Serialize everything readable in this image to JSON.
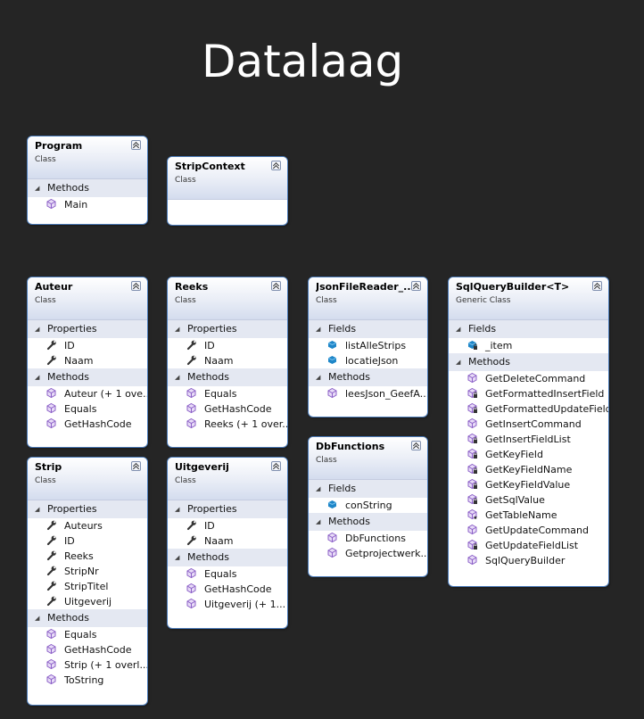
{
  "diagram_title": "Datalaag",
  "colors": {
    "background": "#252525",
    "border": "#4a7ab8",
    "method_icon": "#8b5fc7",
    "field_icon": "#1e86c8"
  },
  "classes": [
    {
      "name": "Program",
      "kind": "Class",
      "sections": [
        {
          "title": "Methods",
          "members": [
            {
              "label": "Main",
              "icon": "method-icon"
            }
          ]
        }
      ]
    },
    {
      "name": "StripContext",
      "kind": "Class",
      "sections": []
    },
    {
      "name": "Auteur",
      "kind": "Class",
      "sections": [
        {
          "title": "Properties",
          "members": [
            {
              "label": "ID",
              "icon": "wrench-icon"
            },
            {
              "label": "Naam",
              "icon": "wrench-icon"
            }
          ]
        },
        {
          "title": "Methods",
          "members": [
            {
              "label": "Auteur (+ 1 ove...",
              "icon": "method-icon"
            },
            {
              "label": "Equals",
              "icon": "method-icon"
            },
            {
              "label": "GetHashCode",
              "icon": "method-icon"
            }
          ]
        }
      ]
    },
    {
      "name": "Reeks",
      "kind": "Class",
      "sections": [
        {
          "title": "Properties",
          "members": [
            {
              "label": "ID",
              "icon": "wrench-icon"
            },
            {
              "label": "Naam",
              "icon": "wrench-icon"
            }
          ]
        },
        {
          "title": "Methods",
          "members": [
            {
              "label": "Equals",
              "icon": "method-icon"
            },
            {
              "label": "GetHashCode",
              "icon": "method-icon"
            },
            {
              "label": "Reeks (+ 1 over...",
              "icon": "method-icon"
            }
          ]
        }
      ]
    },
    {
      "name": "JsonFileReader_...",
      "kind": "Class",
      "sections": [
        {
          "title": "Fields",
          "members": [
            {
              "label": "listAlleStrips",
              "icon": "field-icon"
            },
            {
              "label": "locatieJson",
              "icon": "field-icon"
            }
          ]
        },
        {
          "title": "Methods",
          "members": [
            {
              "label": "leesJson_GeefA...",
              "icon": "method-icon"
            }
          ]
        }
      ]
    },
    {
      "name": "SqlQueryBuilder<T>",
      "kind": "Generic Class",
      "sections": [
        {
          "title": "Fields",
          "members": [
            {
              "label": "_item",
              "icon": "private-field-icon"
            }
          ]
        },
        {
          "title": "Methods",
          "members": [
            {
              "label": "GetDeleteCommand",
              "icon": "method-icon"
            },
            {
              "label": "GetFormattedInsertField",
              "icon": "private-method-icon"
            },
            {
              "label": "GetFormattedUpdateField",
              "icon": "private-method-icon"
            },
            {
              "label": "GetInsertCommand",
              "icon": "method-icon"
            },
            {
              "label": "GetInsertFieldList",
              "icon": "private-method-icon"
            },
            {
              "label": "GetKeyField",
              "icon": "private-method-icon"
            },
            {
              "label": "GetKeyFieldName",
              "icon": "private-method-icon"
            },
            {
              "label": "GetKeyFieldValue",
              "icon": "private-method-icon"
            },
            {
              "label": "GetSqlValue",
              "icon": "private-method-icon"
            },
            {
              "label": "GetTableName",
              "icon": "protected-method-icon"
            },
            {
              "label": "GetUpdateCommand",
              "icon": "method-icon"
            },
            {
              "label": "GetUpdateFieldList",
              "icon": "private-method-icon"
            },
            {
              "label": "SqlQueryBuilder",
              "icon": "method-icon"
            }
          ]
        }
      ]
    },
    {
      "name": "Strip",
      "kind": "Class",
      "sections": [
        {
          "title": "Properties",
          "members": [
            {
              "label": "Auteurs",
              "icon": "wrench-icon"
            },
            {
              "label": "ID",
              "icon": "wrench-icon"
            },
            {
              "label": "Reeks",
              "icon": "wrench-icon"
            },
            {
              "label": "StripNr",
              "icon": "wrench-icon"
            },
            {
              "label": "StripTitel",
              "icon": "wrench-icon"
            },
            {
              "label": "Uitgeverij",
              "icon": "wrench-icon"
            }
          ]
        },
        {
          "title": "Methods",
          "members": [
            {
              "label": "Equals",
              "icon": "method-icon"
            },
            {
              "label": "GetHashCode",
              "icon": "method-icon"
            },
            {
              "label": "Strip (+ 1 overl...",
              "icon": "method-icon"
            },
            {
              "label": "ToString",
              "icon": "method-icon"
            }
          ]
        }
      ]
    },
    {
      "name": "Uitgeverij",
      "kind": "Class",
      "sections": [
        {
          "title": "Properties",
          "members": [
            {
              "label": "ID",
              "icon": "wrench-icon"
            },
            {
              "label": "Naam",
              "icon": "wrench-icon"
            }
          ]
        },
        {
          "title": "Methods",
          "members": [
            {
              "label": "Equals",
              "icon": "method-icon"
            },
            {
              "label": "GetHashCode",
              "icon": "method-icon"
            },
            {
              "label": "Uitgeverij (+ 1...",
              "icon": "method-icon"
            }
          ]
        }
      ]
    },
    {
      "name": "DbFunctions",
      "kind": "Class",
      "sections": [
        {
          "title": "Fields",
          "members": [
            {
              "label": "conString",
              "icon": "field-icon"
            }
          ]
        },
        {
          "title": "Methods",
          "members": [
            {
              "label": "DbFunctions",
              "icon": "method-icon"
            },
            {
              "label": "Getprojectwerk...",
              "icon": "method-icon"
            }
          ]
        }
      ]
    }
  ]
}
